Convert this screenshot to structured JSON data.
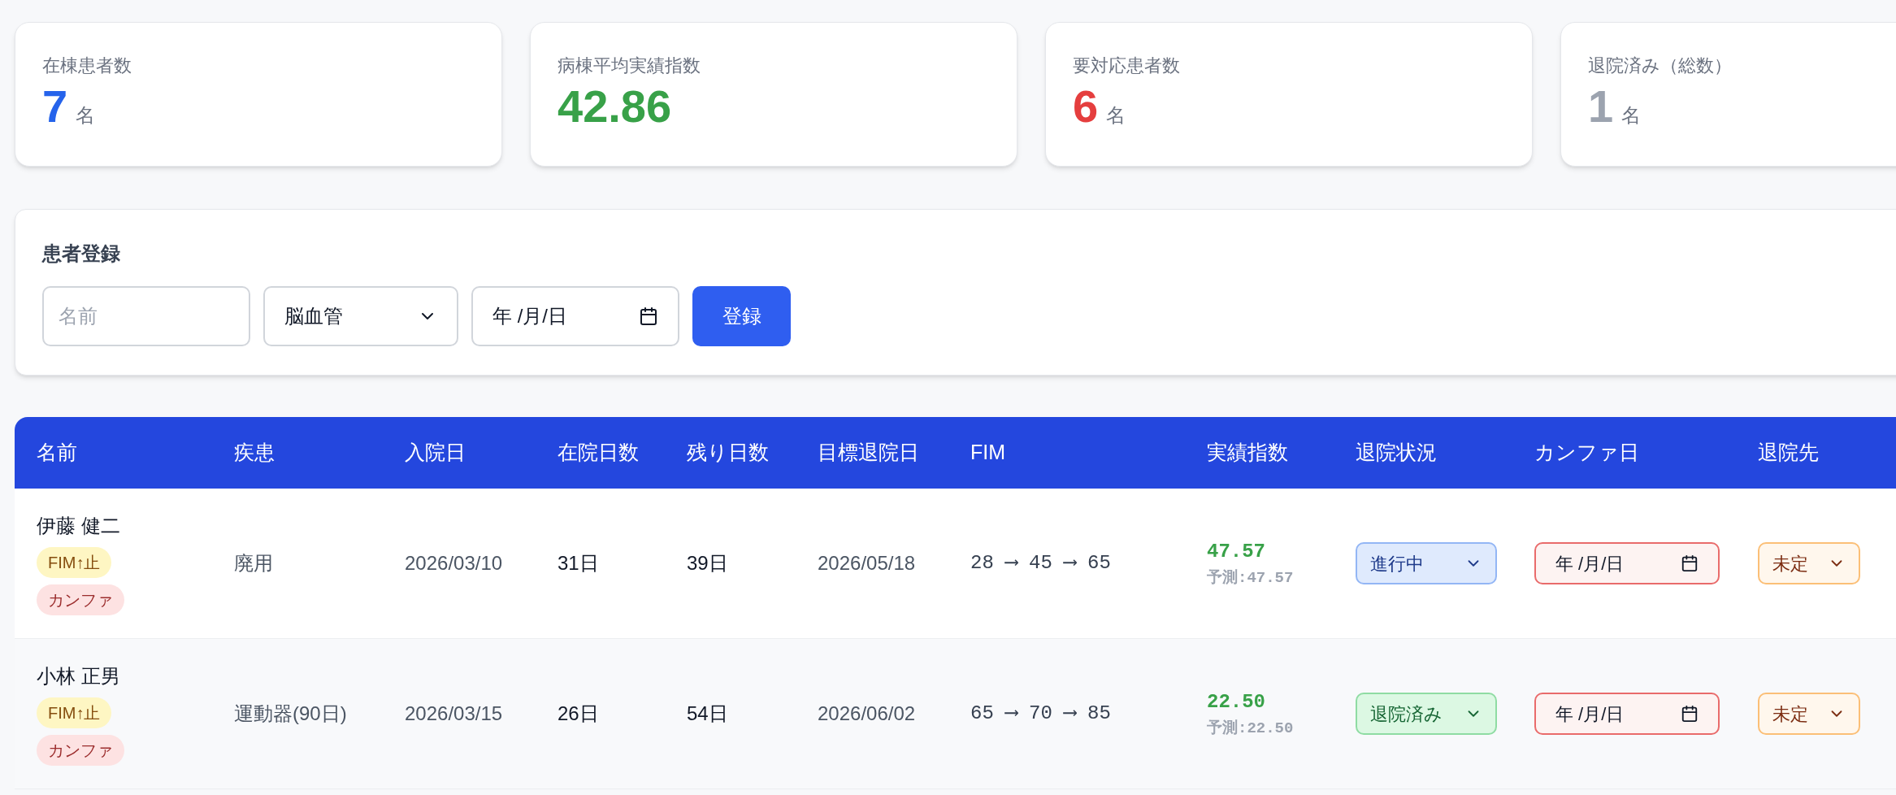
{
  "stats": [
    {
      "label": "在棟患者数",
      "value": "7",
      "unit": "名",
      "color": "#2563eb"
    },
    {
      "label": "病棟平均実績指数",
      "value": "42.86",
      "color": "#38a148"
    },
    {
      "label": "要対応患者数",
      "value": "6",
      "unit": "名",
      "color": "#e53e3e"
    },
    {
      "label": "退院済み（総数）",
      "value": "1",
      "unit": "名",
      "color": "#9ca3af"
    }
  ],
  "registration": {
    "title": "患者登録",
    "name_field": {
      "placeholder": "名前"
    },
    "disease_select": {
      "value": "脳血管"
    },
    "date_field": {
      "value": "年 /月/日"
    },
    "submit_button": "登録"
  },
  "table": {
    "columns": [
      "名前",
      "疾患",
      "入院日",
      "在院日数",
      "残り日数",
      "目標退院日",
      "FIM",
      "実績指数",
      "退院状況",
      "カンファ日",
      "退院先"
    ],
    "rows": [
      {
        "name": "伊藤 健二",
        "tags": [
          {
            "label": "FIM↑止",
            "kind": "warning"
          },
          {
            "label": "カンファ",
            "kind": "alert"
          }
        ],
        "disease": "廃用",
        "admission_date": "2026/03/10",
        "days_in": "31日",
        "days_left": "39日",
        "target_discharge": "2026/05/18",
        "fim": "28 ⟶ 45 ⟶ 65",
        "index": "47.57",
        "predicted": "予測:47.57",
        "status": {
          "value": "進行中",
          "kind": "in_progress"
        },
        "conference_date": {
          "value": "年 /月/日",
          "overdue": true
        },
        "destination": {
          "value": "未定",
          "kind": "undecided"
        }
      },
      {
        "name": "小林 正男",
        "tags": [
          {
            "label": "FIM↑止",
            "kind": "warning"
          },
          {
            "label": "カンファ",
            "kind": "alert"
          }
        ],
        "disease": "運動器(90日)",
        "admission_date": "2026/03/15",
        "days_in": "26日",
        "days_left": "54日",
        "target_discharge": "2026/06/02",
        "fim": "65 ⟶ 70 ⟶ 85",
        "index": "22.50",
        "predicted": "予測:22.50",
        "status": {
          "value": "退院済み",
          "kind": "discharged"
        },
        "conference_date": {
          "value": "年 /月/日",
          "overdue": true
        },
        "destination": {
          "value": "未定",
          "kind": "undecided"
        }
      }
    ]
  }
}
